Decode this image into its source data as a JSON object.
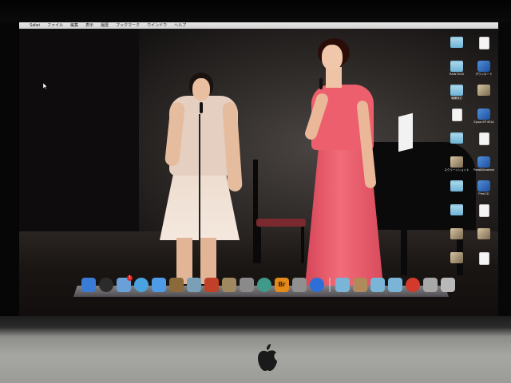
{
  "menubar": {
    "apple_glyph": "",
    "app_name": "Safari",
    "menus": [
      "ファイル",
      "編集",
      "表示",
      "履歴",
      "ブックマーク",
      "ウインドウ",
      "ヘルプ"
    ]
  },
  "desktop_icons": [
    {
      "label": "",
      "kind": "folder"
    },
    {
      "label": "",
      "kind": "doc"
    },
    {
      "label": "RAINT2010",
      "kind": "folder"
    },
    {
      "label": "ダウンロード",
      "kind": "app"
    },
    {
      "label": "増補改訂",
      "kind": "folder"
    },
    {
      "label": "",
      "kind": "img"
    },
    {
      "label": "",
      "kind": "doc"
    },
    {
      "label": "Epson EP-901A",
      "kind": "app"
    },
    {
      "label": "",
      "kind": "folder"
    },
    {
      "label": "",
      "kind": "doc"
    },
    {
      "label": "スクリーンショット",
      "kind": "img"
    },
    {
      "label": "PartsBGmaterial",
      "kind": "app"
    },
    {
      "label": "",
      "kind": "folder"
    },
    {
      "label": "Print CD",
      "kind": "app"
    },
    {
      "label": "",
      "kind": "folder"
    },
    {
      "label": "",
      "kind": "doc"
    },
    {
      "label": "",
      "kind": "img"
    },
    {
      "label": "",
      "kind": "img"
    },
    {
      "label": "",
      "kind": "img"
    },
    {
      "label": "",
      "kind": "doc"
    }
  ],
  "dock": {
    "items": [
      {
        "name": "finder-icon",
        "color": "#3a7bd5"
      },
      {
        "name": "dashboard-icon",
        "color": "#2b2b2b"
      },
      {
        "name": "mail-icon",
        "color": "#6aa0d8",
        "badge": "1"
      },
      {
        "name": "safari-icon",
        "color": "#4aa3e0"
      },
      {
        "name": "ichat-icon",
        "color": "#4f9be8"
      },
      {
        "name": "address-book-icon",
        "color": "#8a6a3a"
      },
      {
        "name": "iphoto-icon",
        "color": "#7aa0b8"
      },
      {
        "name": "photo-booth-icon",
        "color": "#c04028"
      },
      {
        "name": "preview-icon",
        "color": "#a08860"
      },
      {
        "name": "itunes-icon",
        "color": "#8a8a8a"
      },
      {
        "name": "time-machine-icon",
        "color": "#3f9a8a"
      },
      {
        "name": "bridge-icon",
        "color": "#e48a1a",
        "label": "Br"
      },
      {
        "name": "disk-utility-icon",
        "color": "#909090"
      },
      {
        "name": "system-preferences-icon",
        "color": "#2d6fd6"
      },
      {
        "name": "applications-folder-icon",
        "color": "#7ab4d6"
      },
      {
        "name": "documents-stack-icon",
        "color": "#b08a5a"
      },
      {
        "name": "downloads-folder-icon",
        "color": "#7ab4d6"
      },
      {
        "name": "folder-icon",
        "color": "#7ab4d6"
      },
      {
        "name": "no-entry-icon",
        "color": "#d33a2c"
      },
      {
        "name": "stack-icon",
        "color": "#a8a8a8"
      },
      {
        "name": "trash-icon",
        "color": "#b8b8b8"
      }
    ]
  }
}
